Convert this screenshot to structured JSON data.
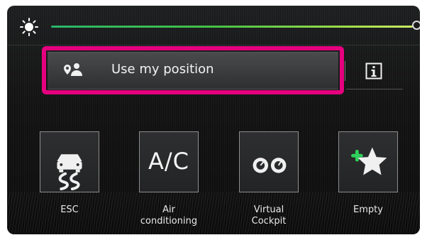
{
  "slider": {
    "name": "brightness",
    "level": 1.0,
    "icon": "brightness-icon"
  },
  "position": {
    "label": "Use my position",
    "icon": "location-person-icon",
    "highlight_color": "#e5007e"
  },
  "info": {
    "icon": "info-icon",
    "glyph": "i"
  },
  "tiles": [
    {
      "label": "ESC",
      "icon": "esc-skid-car-icon"
    },
    {
      "label": "Air\nconditioning",
      "icon_text": "A/C",
      "icon": "ac-icon"
    },
    {
      "label": "Virtual\nCockpit",
      "icon": "virtual-cockpit-gauges-icon"
    },
    {
      "label": "Empty",
      "icon": "add-favorite-star-icon"
    }
  ],
  "colors": {
    "background": "#141414",
    "accent_green": "#2fd05b",
    "slider_start": "#2bb56a",
    "slider_end": "#c9ea66"
  }
}
